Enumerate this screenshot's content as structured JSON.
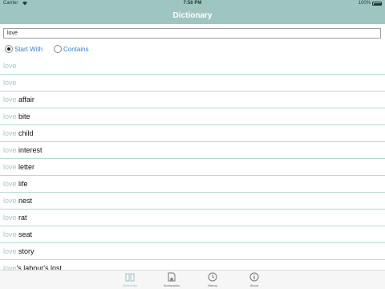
{
  "status_bar": {
    "carrier": "Carrier",
    "time": "7:56 PM",
    "battery": "100%"
  },
  "nav": {
    "title": "Dictionary"
  },
  "search": {
    "value": "love"
  },
  "modes": {
    "start_with": "Start With",
    "contains": "Contains",
    "selected": "start_with"
  },
  "results": [
    {
      "prefix": "love",
      "rest": ""
    },
    {
      "prefix": "love",
      "rest": ""
    },
    {
      "prefix": "love",
      "rest": " affair"
    },
    {
      "prefix": "love",
      "rest": " bite"
    },
    {
      "prefix": "love",
      "rest": " child"
    },
    {
      "prefix": "love",
      "rest": " interest"
    },
    {
      "prefix": "love",
      "rest": " letter"
    },
    {
      "prefix": "love",
      "rest": " life"
    },
    {
      "prefix": "love",
      "rest": " nest"
    },
    {
      "prefix": "love",
      "rest": " rat"
    },
    {
      "prefix": "love",
      "rest": " seat"
    },
    {
      "prefix": "love",
      "rest": " story"
    },
    {
      "prefix": "love",
      "rest": "'s labour's lost"
    }
  ],
  "tabs": {
    "dictionary": "Dictionary",
    "bookmarks": "Bookmarks",
    "history": "History",
    "about": "About",
    "active": "dictionary"
  },
  "colors": {
    "accent": "#9fc5c1",
    "link": "#3a7fd0",
    "prefix": "#a6c8c4",
    "divider": "#b9d8d4"
  }
}
